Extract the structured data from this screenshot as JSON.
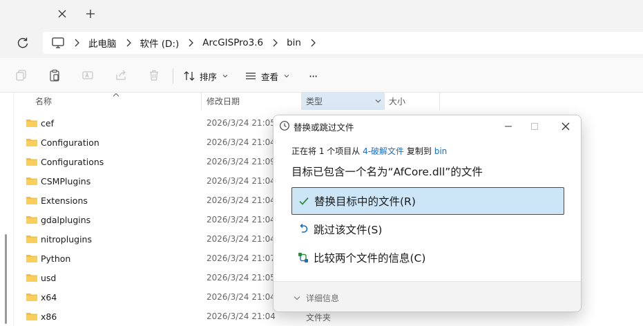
{
  "addressbar": {
    "crumbs": [
      "此电脑",
      "软件 (D:)",
      "ArcGISPro3.6",
      "bin"
    ]
  },
  "toolbar": {
    "sort_label": "排序",
    "view_label": "查看",
    "more_label": "···"
  },
  "columns": {
    "name": "名称",
    "date": "修改日期",
    "type": "类型",
    "size": "大小"
  },
  "files": [
    {
      "name": "cef",
      "date": "2026/3/24 21:05",
      "type": ""
    },
    {
      "name": "Configuration",
      "date": "2026/3/24 21:04",
      "type": ""
    },
    {
      "name": "Configurations",
      "date": "2026/3/24 21:09",
      "type": ""
    },
    {
      "name": "CSMPlugins",
      "date": "2026/3/24 21:04",
      "type": ""
    },
    {
      "name": "Extensions",
      "date": "2026/3/24 21:04",
      "type": ""
    },
    {
      "name": "gdalplugins",
      "date": "2026/3/24 21:04",
      "type": ""
    },
    {
      "name": "nitroplugins",
      "date": "2026/3/24 21:04",
      "type": ""
    },
    {
      "name": "Python",
      "date": "2026/3/24 21:07",
      "type": ""
    },
    {
      "name": "usd",
      "date": "2026/3/24 21:05",
      "type": ""
    },
    {
      "name": "x64",
      "date": "2026/3/24 21:04",
      "type": ""
    },
    {
      "name": "x86",
      "date": "2026/3/24 21:04",
      "type": "文件夹"
    }
  ],
  "dialog": {
    "title": "替换或跳过文件",
    "line1_prefix": "正在将 1 个项目从 ",
    "line1_source": "4-破解文件",
    "line1_middle": " 复制到 ",
    "line1_dest": "bin",
    "headline": "目标已包含一个名为“AfCore.dll”的文件",
    "options": [
      {
        "label": "替换目标中的文件(R)",
        "selected": true
      },
      {
        "label": "跳过该文件(S)",
        "selected": false
      },
      {
        "label": "比较两个文件的信息(C)",
        "selected": false
      }
    ],
    "more_details": "详细信息"
  },
  "colors": {
    "accent": "#1b6fb5",
    "selection": "#cde6f7",
    "folder": "#f2bf42",
    "check": "#2e8b3d"
  }
}
